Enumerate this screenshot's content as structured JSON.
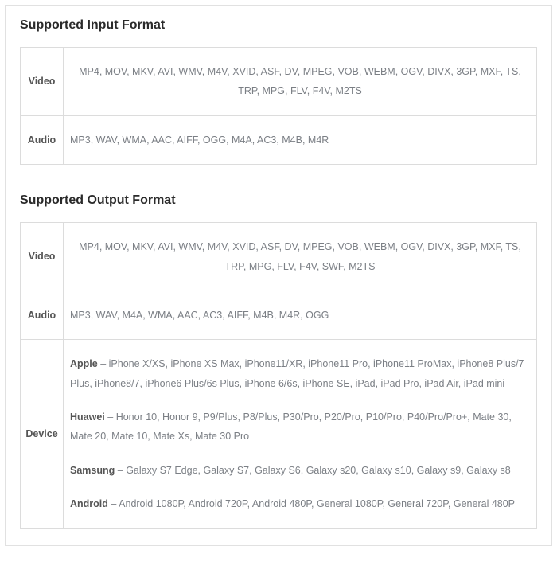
{
  "sections": {
    "input": {
      "title": "Supported Input Format",
      "rows": [
        {
          "label": "Video",
          "value": "MP4, MOV, MKV, AVI, WMV, M4V, XVID, ASF, DV, MPEG, VOB, WEBM, OGV, DIVX, 3GP, MXF, TS, TRP, MPG, FLV, F4V, M2TS",
          "align": "center"
        },
        {
          "label": "Audio",
          "value": "MP3, WAV, WMA, AAC, AIFF, OGG, M4A, AC3, M4B, M4R",
          "align": "left"
        }
      ]
    },
    "output": {
      "title": "Supported Output Format",
      "rows": [
        {
          "label": "Video",
          "value": "MP4, MOV, MKV, AVI, WMV, M4V, XVID, ASF, DV, MPEG, VOB, WEBM, OGV, DIVX, 3GP, MXF, TS, TRP, MPG, FLV, F4V, SWF, M2TS",
          "align": "center"
        },
        {
          "label": "Audio",
          "value": "MP3, WAV, M4A, WMA, AAC, AC3, AIFF, M4B, M4R, OGG",
          "align": "left"
        }
      ],
      "device_row": {
        "label": "Device",
        "brands": [
          {
            "name": "Apple",
            "models": "iPhone X/XS, iPhone XS Max, iPhone11/XR, iPhone11 Pro, iPhone11 ProMax, iPhone8 Plus/7 Plus, iPhone8/7, iPhone6 Plus/6s Plus, iPhone 6/6s, iPhone SE, iPad, iPad Pro, iPad Air, iPad mini"
          },
          {
            "name": "Huawei",
            "models": "Honor 10, Honor 9, P9/Plus, P8/Plus, P30/Pro, P20/Pro, P10/Pro, P40/Pro/Pro+, Mate 30, Mate 20, Mate 10, Mate Xs, Mate 30 Pro"
          },
          {
            "name": "Samsung",
            "models": "Galaxy S7 Edge, Galaxy S7, Galaxy S6, Galaxy s20, Galaxy s10, Galaxy s9, Galaxy s8"
          },
          {
            "name": "Android",
            "models": "Android 1080P, Android 720P, Android 480P, General 1080P, General 720P, General 480P"
          }
        ]
      }
    }
  }
}
